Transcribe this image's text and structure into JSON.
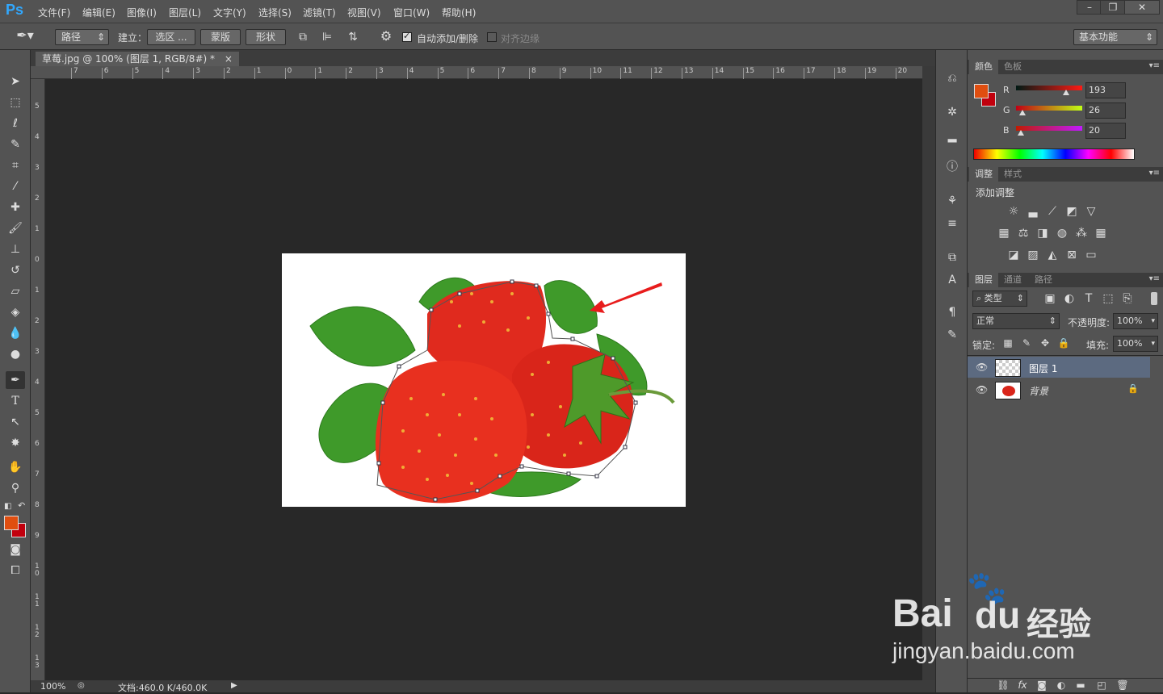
{
  "menubar": {
    "logo": "Ps",
    "items": [
      "文件(F)",
      "编辑(E)",
      "图像(I)",
      "图层(L)",
      "文字(Y)",
      "选择(S)",
      "滤镜(T)",
      "视图(V)",
      "窗口(W)",
      "帮助(H)"
    ],
    "window_buttons": [
      "–",
      "❐",
      "✕"
    ]
  },
  "options": {
    "mode": "路径",
    "make_label": "建立：",
    "selection_button": "选区 ...",
    "mask_button": "蒙版",
    "shape_button": "形状",
    "auto_add_delete": "自动添加/删除",
    "align_edges": "对齐边缘",
    "workspace": "基本功能"
  },
  "document": {
    "tab_title": "草莓.jpg @ 100% (图层 1, RGB/8#) *",
    "close": "×"
  },
  "ruler": {
    "h_labels": [
      "7",
      "6",
      "5",
      "4",
      "3",
      "2",
      "1",
      "0",
      "1",
      "2",
      "3",
      "4",
      "5",
      "6",
      "7",
      "8",
      "9",
      "10",
      "11",
      "12",
      "13",
      "14",
      "15",
      "16",
      "17",
      "18",
      "19",
      "20"
    ],
    "v_labels": [
      "5",
      "4",
      "3",
      "2",
      "1",
      "0",
      "1",
      "2",
      "3",
      "4",
      "5",
      "6",
      "7",
      "8",
      "9",
      "1 0",
      "1 1",
      "1 2",
      "1 3"
    ]
  },
  "status": {
    "zoom": "100%",
    "doc_size": "文档:460.0 K/460.0K"
  },
  "color_panel": {
    "tabs": [
      "颜色",
      "色板"
    ],
    "r_label": "R",
    "r": "193",
    "g_label": "G",
    "g": "26",
    "b_label": "B",
    "b": "20",
    "fg_color": "#e04e10",
    "bg_color": "#c1000e",
    "slider_levels": {
      "r": 0.757,
      "g": 0.102,
      "b": 0.078
    }
  },
  "adjust_panel": {
    "tabs": [
      "调整",
      "样式"
    ],
    "title": "添加调整"
  },
  "layers_panel": {
    "tabs": [
      "图层",
      "通道",
      "路径"
    ],
    "filter": "类型",
    "blend": "正常",
    "opacity_label": "不透明度:",
    "opacity": "100%",
    "lock_label": "锁定:",
    "fill_label": "填充:",
    "fill": "100%",
    "layers": [
      {
        "name": "图层 1",
        "selected": true
      },
      {
        "name": "背景",
        "selected": false,
        "locked": true
      }
    ]
  },
  "watermark": {
    "brand": "Bai",
    "brand2": "du",
    "brand_cn": "经验",
    "url": "jingyan.baidu.com"
  }
}
